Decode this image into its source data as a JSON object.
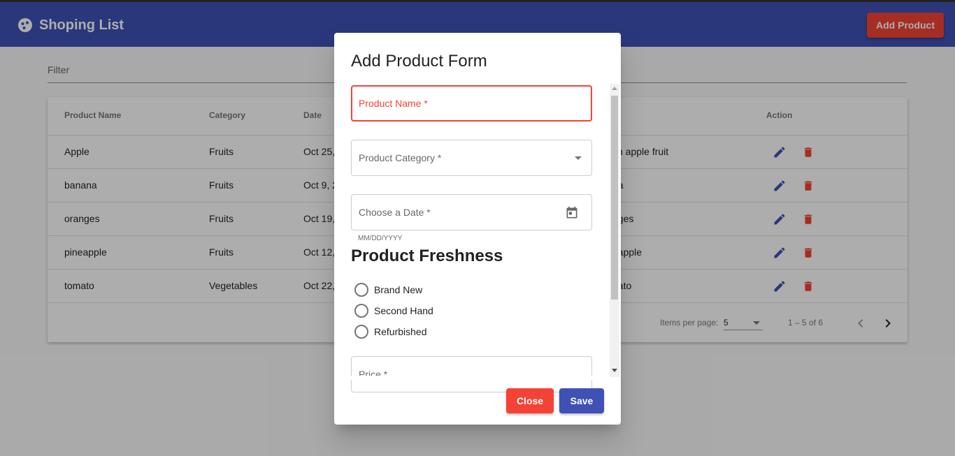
{
  "app": {
    "title": "Shoping List",
    "add_button_label": "Add Product",
    "brand_color": "#3f51b5",
    "warn_color": "#f44336"
  },
  "filter": {
    "placeholder": "Filter"
  },
  "table": {
    "columns": [
      "Product Name",
      "Category",
      "Date",
      "Action"
    ],
    "rows": [
      {
        "name": "Apple",
        "category": "Fruits",
        "date": "Oct 25,",
        "comment": "sh apple fruit"
      },
      {
        "name": "banana",
        "category": "Fruits",
        "date": "Oct 9, 2",
        "comment": "na"
      },
      {
        "name": "oranges",
        "category": "Fruits",
        "date": "Oct 19,",
        "comment": "nges"
      },
      {
        "name": "pineapple",
        "category": "Fruits",
        "date": "Oct 12,",
        "comment": "eapple"
      },
      {
        "name": "tomato",
        "category": "Vegetables",
        "date": "Oct 22,",
        "comment": "nato"
      }
    ],
    "row_icons": {
      "edit": "pencil-icon",
      "delete": "trash-icon"
    }
  },
  "paginator": {
    "items_per_page_label": "Items per page:",
    "items_per_page_value": "5",
    "range_label": "1 – 5 of 6"
  },
  "dialog": {
    "title": "Add Product Form",
    "product_name_label": "Product Name *",
    "product_category_label": "Product Category *",
    "date_label": "Choose a Date *",
    "date_hint": "MM/DD/YYYY",
    "freshness_title": "Product Freshness",
    "freshness_options": [
      "Brand New",
      "Second Hand",
      "Refurbished"
    ],
    "price_label": "Price *",
    "close_label": "Close",
    "save_label": "Save"
  }
}
